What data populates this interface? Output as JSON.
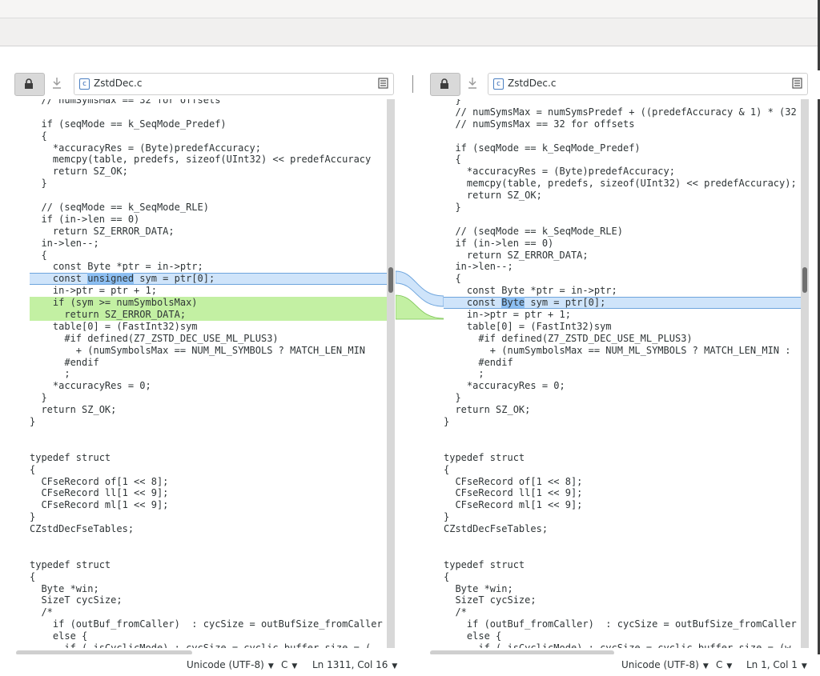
{
  "left": {
    "file_name": "ZstdDec.c",
    "status": {
      "encoding": "Unicode (UTF-8)",
      "language": "C",
      "position": "Ln 1311, Col 16"
    },
    "lines": [
      {
        "t": "  // numSymsMax == 32 for offsets",
        "k": ""
      },
      {
        "t": "",
        "k": ""
      },
      {
        "t": "  if (seqMode == k_SeqMode_Predef)",
        "k": ""
      },
      {
        "t": "  {",
        "k": ""
      },
      {
        "t": "    *accuracyRes = (Byte)predefAccuracy;",
        "k": ""
      },
      {
        "t": "    memcpy(table, predefs, sizeof(UInt32) << predefAccuracy",
        "k": ""
      },
      {
        "t": "    return SZ_OK;",
        "k": ""
      },
      {
        "t": "  }",
        "k": ""
      },
      {
        "t": "",
        "k": ""
      },
      {
        "t": "  // (seqMode == k_SeqMode_RLE)",
        "k": ""
      },
      {
        "t": "  if (in->len == 0)",
        "k": ""
      },
      {
        "t": "    return SZ_ERROR_DATA;",
        "k": ""
      },
      {
        "t": "  in->len--;",
        "k": ""
      },
      {
        "t": "  {",
        "k": ""
      },
      {
        "t": "    const Byte *ptr = in->ptr;",
        "k": ""
      },
      {
        "t": "    const unsigned sym = ptr[0];",
        "k": "chg",
        "hl": "unsigned"
      },
      {
        "t": "    in->ptr = ptr + 1;",
        "k": ""
      },
      {
        "t": "    if (sym >= numSymbolsMax)",
        "k": "ins"
      },
      {
        "t": "      return SZ_ERROR_DATA;",
        "k": "ins"
      },
      {
        "t": "    table[0] = (FastInt32)sym",
        "k": ""
      },
      {
        "t": "      #if defined(Z7_ZSTD_DEC_USE_ML_PLUS3)",
        "k": ""
      },
      {
        "t": "        + (numSymbolsMax == NUM_ML_SYMBOLS ? MATCH_LEN_MIN",
        "k": ""
      },
      {
        "t": "      #endif",
        "k": ""
      },
      {
        "t": "      ;",
        "k": ""
      },
      {
        "t": "    *accuracyRes = 0;",
        "k": ""
      },
      {
        "t": "  }",
        "k": ""
      },
      {
        "t": "  return SZ_OK;",
        "k": ""
      },
      {
        "t": "}",
        "k": ""
      },
      {
        "t": "",
        "k": ""
      },
      {
        "t": "",
        "k": ""
      },
      {
        "t": "typedef struct",
        "k": ""
      },
      {
        "t": "{",
        "k": ""
      },
      {
        "t": "  CFseRecord of[1 << 8];",
        "k": ""
      },
      {
        "t": "  CFseRecord ll[1 << 9];",
        "k": ""
      },
      {
        "t": "  CFseRecord ml[1 << 9];",
        "k": ""
      },
      {
        "t": "}",
        "k": ""
      },
      {
        "t": "CZstdDecFseTables;",
        "k": ""
      },
      {
        "t": "",
        "k": ""
      },
      {
        "t": "",
        "k": ""
      },
      {
        "t": "typedef struct",
        "k": ""
      },
      {
        "t": "{",
        "k": ""
      },
      {
        "t": "  Byte *win;",
        "k": ""
      },
      {
        "t": "  SizeT cycSize;",
        "k": ""
      },
      {
        "t": "  /*",
        "k": ""
      },
      {
        "t": "    if (outBuf_fromCaller)  : cycSize = outBufSize_fromCaller",
        "k": ""
      },
      {
        "t": "    else {",
        "k": ""
      },
      {
        "t": "      if ( isCyclicMode) : cycSize = cyclic_buffer_size = (",
        "k": ""
      }
    ]
  },
  "right": {
    "file_name": "ZstdDec.c",
    "status": {
      "encoding": "Unicode (UTF-8)",
      "language": "C",
      "position": "Ln 1, Col 1"
    },
    "lines": [
      {
        "t": "  }",
        "k": ""
      },
      {
        "t": "  // numSymsMax = numSymsPredef + ((predefAccuracy & 1) * (32",
        "k": ""
      },
      {
        "t": "  // numSymsMax == 32 for offsets",
        "k": ""
      },
      {
        "t": "",
        "k": ""
      },
      {
        "t": "  if (seqMode == k_SeqMode_Predef)",
        "k": ""
      },
      {
        "t": "  {",
        "k": ""
      },
      {
        "t": "    *accuracyRes = (Byte)predefAccuracy;",
        "k": ""
      },
      {
        "t": "    memcpy(table, predefs, sizeof(UInt32) << predefAccuracy);",
        "k": ""
      },
      {
        "t": "    return SZ_OK;",
        "k": ""
      },
      {
        "t": "  }",
        "k": ""
      },
      {
        "t": "",
        "k": ""
      },
      {
        "t": "  // (seqMode == k_SeqMode_RLE)",
        "k": ""
      },
      {
        "t": "  if (in->len == 0)",
        "k": ""
      },
      {
        "t": "    return SZ_ERROR_DATA;",
        "k": ""
      },
      {
        "t": "  in->len--;",
        "k": ""
      },
      {
        "t": "  {",
        "k": ""
      },
      {
        "t": "    const Byte *ptr = in->ptr;",
        "k": ""
      },
      {
        "t": "    const Byte sym = ptr[0];",
        "k": "chg",
        "hl": "Byte"
      },
      {
        "t": "    in->ptr = ptr + 1;",
        "k": ""
      },
      {
        "t": "    table[0] = (FastInt32)sym",
        "k": ""
      },
      {
        "t": "      #if defined(Z7_ZSTD_DEC_USE_ML_PLUS3)",
        "k": ""
      },
      {
        "t": "        + (numSymbolsMax == NUM_ML_SYMBOLS ? MATCH_LEN_MIN :",
        "k": ""
      },
      {
        "t": "      #endif",
        "k": ""
      },
      {
        "t": "      ;",
        "k": ""
      },
      {
        "t": "    *accuracyRes = 0;",
        "k": ""
      },
      {
        "t": "  }",
        "k": ""
      },
      {
        "t": "  return SZ_OK;",
        "k": ""
      },
      {
        "t": "}",
        "k": ""
      },
      {
        "t": "",
        "k": ""
      },
      {
        "t": "",
        "k": ""
      },
      {
        "t": "typedef struct",
        "k": ""
      },
      {
        "t": "{",
        "k": ""
      },
      {
        "t": "  CFseRecord of[1 << 8];",
        "k": ""
      },
      {
        "t": "  CFseRecord ll[1 << 9];",
        "k": ""
      },
      {
        "t": "  CFseRecord ml[1 << 9];",
        "k": ""
      },
      {
        "t": "}",
        "k": ""
      },
      {
        "t": "CZstdDecFseTables;",
        "k": ""
      },
      {
        "t": "",
        "k": ""
      },
      {
        "t": "",
        "k": ""
      },
      {
        "t": "typedef struct",
        "k": ""
      },
      {
        "t": "{",
        "k": ""
      },
      {
        "t": "  Byte *win;",
        "k": ""
      },
      {
        "t": "  SizeT cycSize;",
        "k": ""
      },
      {
        "t": "  /*",
        "k": ""
      },
      {
        "t": "    if (outBuf_fromCaller)  : cycSize = outBufSize_fromCaller",
        "k": ""
      },
      {
        "t": "    else {",
        "k": ""
      },
      {
        "t": "      if ( isCyclicMode) : cycSize = cyclic_buffer_size = (w",
        "k": ""
      }
    ]
  },
  "colors": {
    "changed": "#cfe4fa",
    "changed_highlight": "#8dbff2",
    "inserted": "#c3f0a3"
  }
}
